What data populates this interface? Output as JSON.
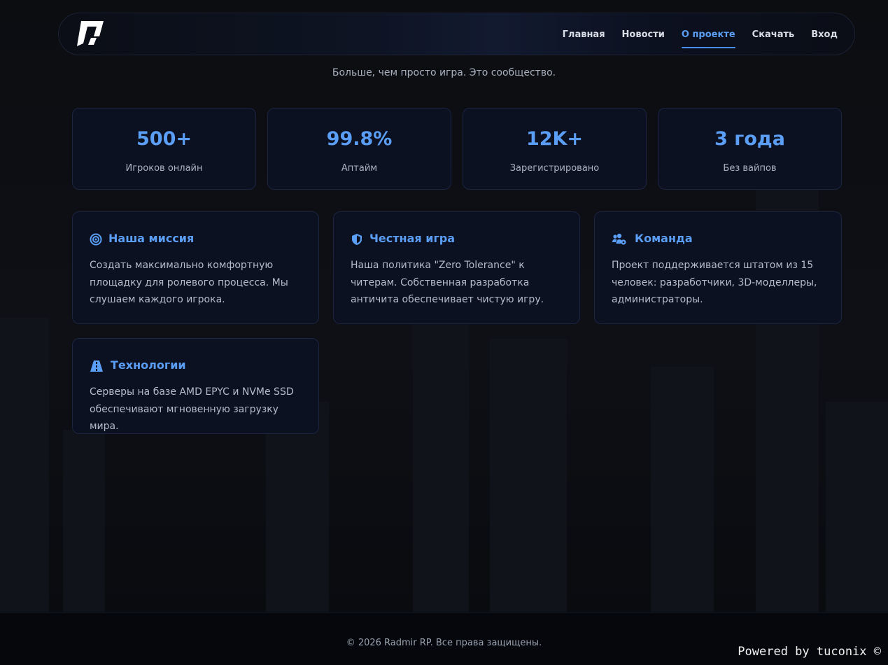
{
  "header": {
    "logo_name": "radmir-logo",
    "nav": [
      {
        "label": "Главная",
        "active": false
      },
      {
        "label": "Новости",
        "active": false
      },
      {
        "label": "О проекте",
        "active": true
      },
      {
        "label": "Скачать",
        "active": false
      },
      {
        "label": "Вход",
        "active": false
      }
    ]
  },
  "tagline": "Больше, чем просто игра. Это сообщество.",
  "stats": [
    {
      "value": "500+",
      "label": "Игроков онлайн"
    },
    {
      "value": "99.8%",
      "label": "Аптайм"
    },
    {
      "value": "12K+",
      "label": "Зарегистрировано"
    },
    {
      "value": "3 года",
      "label": "Без вайпов"
    }
  ],
  "features": [
    {
      "icon": "target-icon",
      "title": "Наша миссия",
      "text": "Создать максимально комфортную площадку для ролевого процесса. Мы слушаем каждого игрока."
    },
    {
      "icon": "shield-icon",
      "title": "Честная игра",
      "text": "Наша политика \"Zero Tolerance\" к читерам. Собственная разработка античита обеспечивает чистую игру."
    },
    {
      "icon": "users-gear-icon",
      "title": "Команда",
      "text": "Проект поддерживается штатом из 15 человек: разработчики, 3D-моделлеры, администраторы."
    },
    {
      "icon": "road-icon",
      "title": "Технологии",
      "text": "Серверы на базе AMD EPYC и NVMe SSD обеспечивают мгновенную загрузку мира."
    }
  ],
  "footer": {
    "copyright": "© 2026 Radmir RP. Все права защищены.",
    "powered": "Powered by tuconix ©"
  },
  "colors": {
    "accent": "#5b9ef5",
    "background": "#0b0c10",
    "card_bg": "#0c1122",
    "card_border": "#1b2540"
  }
}
